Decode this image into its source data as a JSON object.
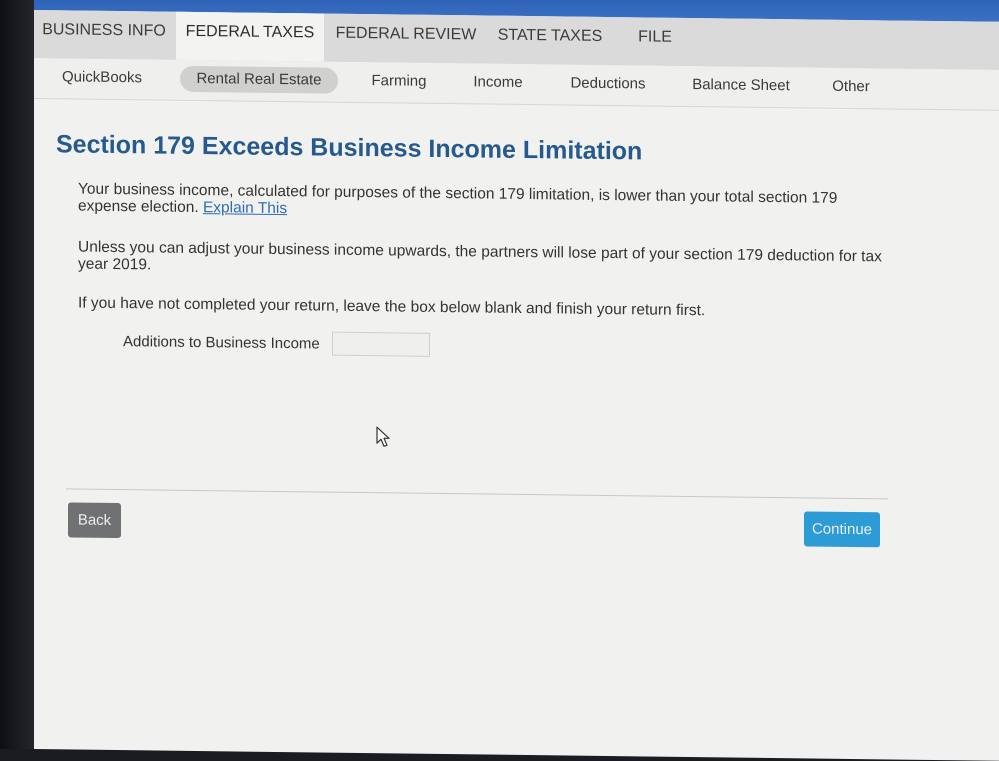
{
  "main_tabs": [
    {
      "label": "BUSINESS INFO",
      "active": false
    },
    {
      "label": "FEDERAL TAXES",
      "active": true
    },
    {
      "label": "FEDERAL REVIEW",
      "active": false
    },
    {
      "label": "STATE TAXES",
      "active": false
    },
    {
      "label": "FILE",
      "active": false
    }
  ],
  "sub_tabs": [
    {
      "label": "QuickBooks",
      "active": false
    },
    {
      "label": "Rental Real Estate",
      "active": true
    },
    {
      "label": "Farming",
      "active": false
    },
    {
      "label": "Income",
      "active": false
    },
    {
      "label": "Deductions",
      "active": false
    },
    {
      "label": "Balance Sheet",
      "active": false
    },
    {
      "label": "Other",
      "active": false
    }
  ],
  "page": {
    "title": "Section 179 Exceeds Business Income Limitation",
    "paragraph1": "Your business income, calculated for purposes of the section 179 limitation, is lower than your total section 179 expense election.",
    "explain_link": "Explain This",
    "paragraph2": "Unless you can adjust your business income upwards, the partners will lose part of your section 179 deduction for tax year 2019.",
    "paragraph3": "If you have not completed your return, leave the box below blank and finish your return first.",
    "field_label": "Additions to Business Income",
    "field_value": ""
  },
  "buttons": {
    "back": "Back",
    "continue": "Continue"
  },
  "colors": {
    "title": "#26598c",
    "link": "#2f6db3",
    "continue_button": "#2d9bd6",
    "back_button": "#6f7173",
    "top_bar": "#3b72c6"
  },
  "icons": {
    "cursor": "mouse-pointer-icon"
  }
}
